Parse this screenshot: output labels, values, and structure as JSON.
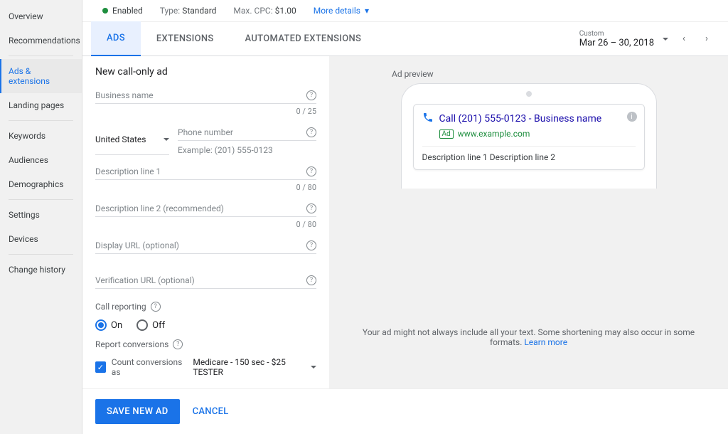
{
  "sidebar": {
    "items": [
      {
        "label": "Overview"
      },
      {
        "label": "Recommendations"
      },
      {
        "divider": true
      },
      {
        "label": "Ads & extensions",
        "active": true
      },
      {
        "label": "Landing pages"
      },
      {
        "divider": true
      },
      {
        "label": "Keywords"
      },
      {
        "label": "Audiences"
      },
      {
        "label": "Demographics"
      },
      {
        "divider": true
      },
      {
        "label": "Settings"
      },
      {
        "label": "Devices"
      },
      {
        "divider": true
      },
      {
        "label": "Change history"
      }
    ]
  },
  "statusbar": {
    "enabled_label": "Enabled",
    "type_label": "Type:",
    "type_value": "Standard",
    "maxcpc_label": "Max. CPC:",
    "maxcpc_value": "$1.00",
    "more_details": "More details"
  },
  "tabs": {
    "ads": "ADS",
    "extensions": "EXTENSIONS",
    "automated": "AUTOMATED EXTENSIONS",
    "daterange_label": "Custom",
    "daterange_value": "Mar 26 – 30, 2018"
  },
  "form": {
    "title": "New call-only ad",
    "business_name": "Business name",
    "business_counter": "0 / 25",
    "country_value": "United States",
    "phone_label": "Phone number",
    "phone_example": "Example: (201) 555-0123",
    "desc1": "Description line 1",
    "desc1_counter": "0 / 80",
    "desc2": "Description line 2 (recommended)",
    "desc2_counter": "0 / 80",
    "display_url": "Display URL (optional)",
    "verification_url": "Verification URL (optional)",
    "call_reporting": "Call reporting",
    "on": "On",
    "off": "Off",
    "report_conversions": "Report conversions",
    "count_conversions_label": "Count conversions as",
    "conversion_value": "Medicare - 150 sec - $25 TESTER"
  },
  "preview": {
    "label": "Ad preview",
    "headline": "Call (201) 555-0123 - Business name",
    "ad_badge": "Ad",
    "url": "www.example.com",
    "desc": "Description line 1 Description line 2",
    "disclaimer": "Your ad might not always include all your text. Some shortening may also occur in some formats. ",
    "learn_more": "Learn more"
  },
  "footer": {
    "save": "SAVE NEW AD",
    "cancel": "CANCEL"
  }
}
